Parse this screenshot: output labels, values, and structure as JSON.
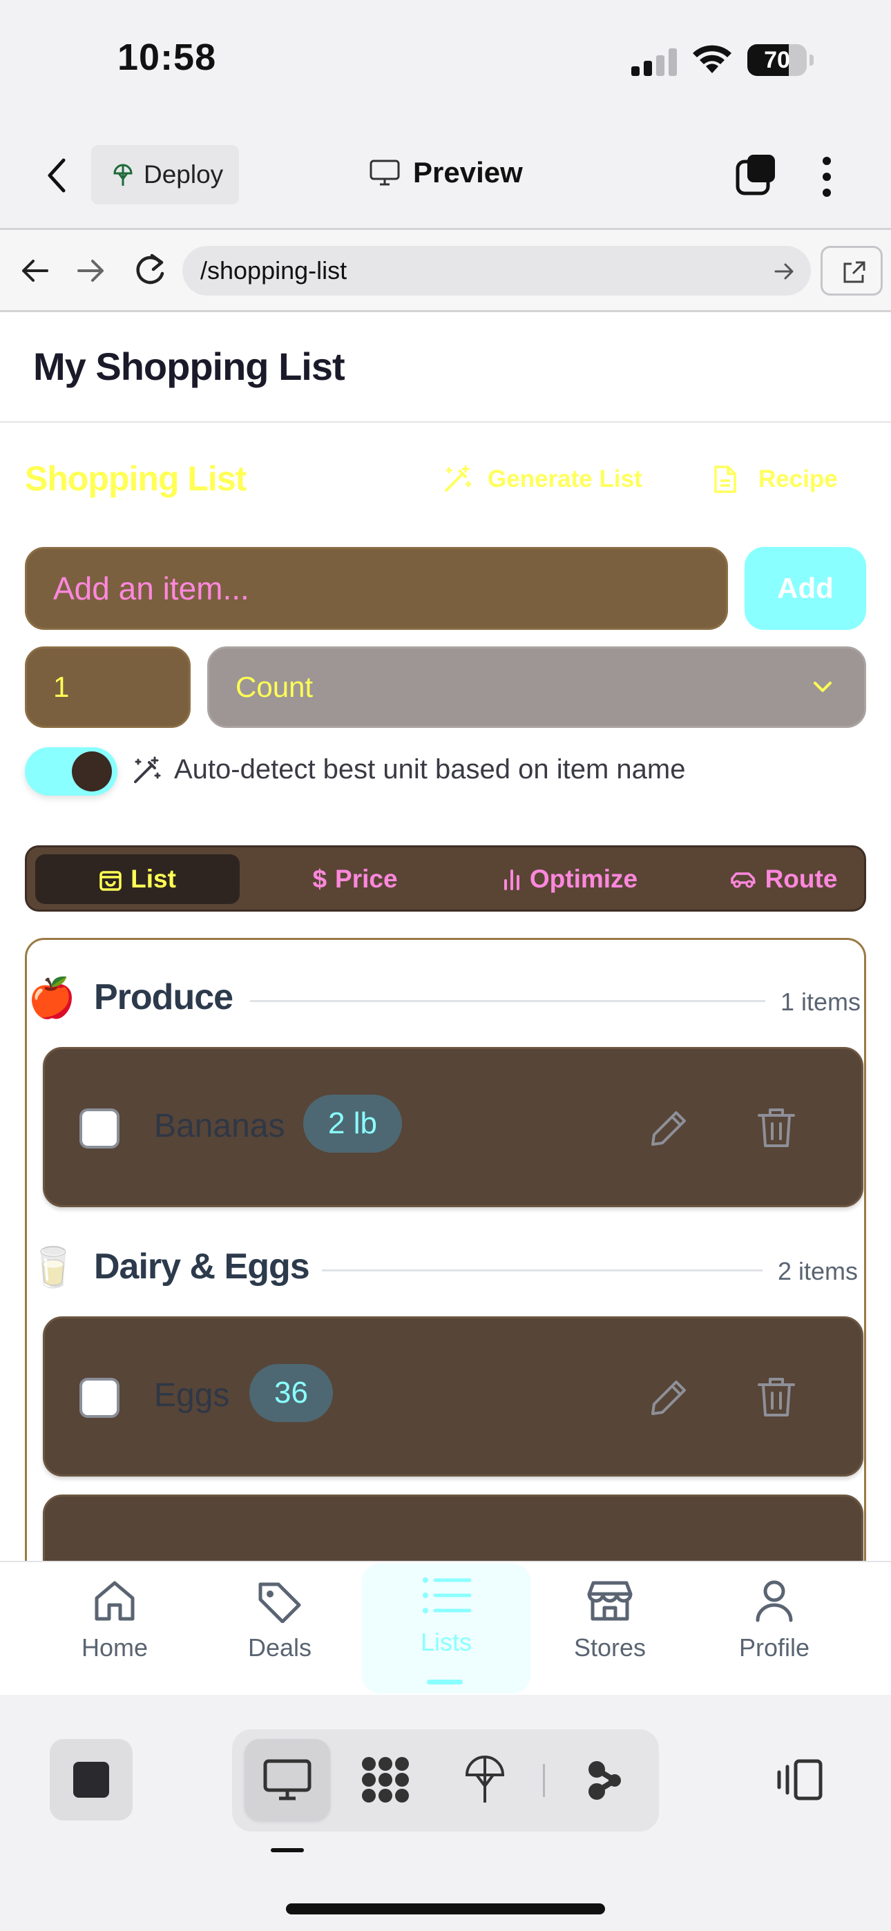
{
  "status_bar": {
    "time": "10:58",
    "battery": "70",
    "battery_level": 0.7
  },
  "app_header": {
    "deploy_label": "Deploy",
    "preview_label": "Preview"
  },
  "browser": {
    "url": "/shopping-list"
  },
  "page": {
    "title": "My Shopping List",
    "section_title": "Shopping List",
    "generate_list_label": "Generate List",
    "recipe_label": "Recipe",
    "item_input_placeholder": "Add an item...",
    "add_button_label": "Add",
    "quantity_value": "1",
    "unit_selected": "Count",
    "auto_detect_on": true,
    "auto_detect_label": "Auto-detect best unit based on item name",
    "tabs": [
      {
        "label": "List",
        "active": true
      },
      {
        "label": "Price",
        "active": false
      },
      {
        "label": "Optimize",
        "active": false
      },
      {
        "label": "Route",
        "active": false
      }
    ],
    "categories": [
      {
        "emoji": "🍎",
        "name": "Produce",
        "count": "1 items",
        "items": [
          {
            "name": "Bananas",
            "qty": "2 lb"
          }
        ]
      },
      {
        "emoji": "🥛",
        "name": "Dairy & Eggs",
        "count": "2 items",
        "items": [
          {
            "name": "Eggs",
            "qty": "36"
          }
        ]
      }
    ]
  },
  "bottom_nav": [
    {
      "label": "Home",
      "icon": "home-icon"
    },
    {
      "label": "Deals",
      "icon": "tag-icon"
    },
    {
      "label": "Lists",
      "icon": "list-icon",
      "active": true
    },
    {
      "label": "Stores",
      "icon": "store-icon"
    },
    {
      "label": "Profile",
      "icon": "user-icon"
    }
  ],
  "colors": {
    "accent_cyan": "#8affff",
    "heading_yellow": "#ffff55",
    "pink": "#ff88dd",
    "item_brown": "#574538",
    "input_brown": "#7b6040"
  }
}
